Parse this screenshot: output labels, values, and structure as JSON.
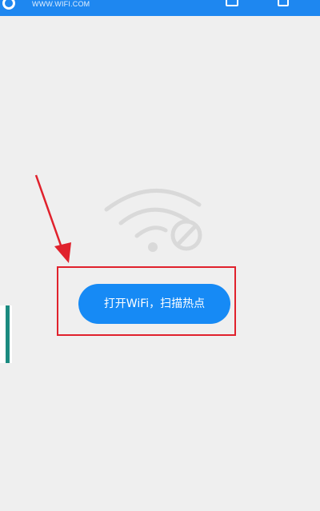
{
  "header": {
    "subtitle": "WWW.WIFI.COM",
    "background_color": "#1e87f0"
  },
  "main": {
    "illustration_icon": "wifi-disabled-icon",
    "primary_button_label": "打开WiFi，扫描热点",
    "primary_button_color": "#168af5"
  },
  "annotation": {
    "highlight_color": "#e0212c",
    "arrow_color": "#e0212c"
  },
  "side_strip_color": "#1b8b80"
}
